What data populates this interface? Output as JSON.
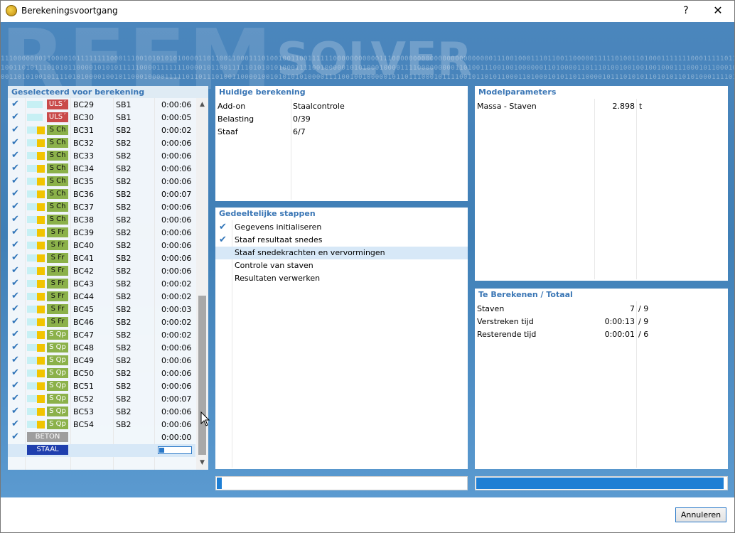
{
  "window": {
    "title": "Berekeningsvoortgang",
    "help_label": "?",
    "close_label": "✕"
  },
  "background": {
    "brand_word_1": "RFEM",
    "brand_word_2": "SOLVER",
    "binary_lines": [
      "1110000000110000101111111100011100101010101000011011001100011101001001100111111000000000001110000000000000000000000001110010001110110011000001111101001101000111111100011111011101010110010011111111111111110000011",
      "1001101011101010110000101010111110000111111100001011001111101010101000111100100000101010001000011110000000001101001110010010000001101000011011101001001001001000111000101100010010111101001100000001110110010001",
      "0011010100101111010100001001011000100001111101101110100110000100101010101000011110010010000010110111000101111001011010110001101000101011011000010111010101101010110101000111101010110011110101110001001010100111"
    ]
  },
  "left_panel": {
    "title": "Geselecteerd voor berekening",
    "rows": [
      {
        "check": "✔",
        "badge": "ULS´",
        "badge_type": "uls",
        "combo": "BC29",
        "sb": "SB1",
        "time": "0:00:06"
      },
      {
        "check": "✔",
        "badge": "ULS´",
        "badge_type": "uls",
        "combo": "BC30",
        "sb": "SB1",
        "time": "0:00:05"
      },
      {
        "check": "✔",
        "badge": "S Ch",
        "badge_type": "sch",
        "combo": "BC31",
        "sb": "SB2",
        "time": "0:00:02"
      },
      {
        "check": "✔",
        "badge": "S Ch",
        "badge_type": "sch",
        "combo": "BC32",
        "sb": "SB2",
        "time": "0:00:06"
      },
      {
        "check": "✔",
        "badge": "S Ch",
        "badge_type": "sch",
        "combo": "BC33",
        "sb": "SB2",
        "time": "0:00:06"
      },
      {
        "check": "✔",
        "badge": "S Ch",
        "badge_type": "sch",
        "combo": "BC34",
        "sb": "SB2",
        "time": "0:00:06"
      },
      {
        "check": "✔",
        "badge": "S Ch",
        "badge_type": "sch",
        "combo": "BC35",
        "sb": "SB2",
        "time": "0:00:06"
      },
      {
        "check": "✔",
        "badge": "S Ch",
        "badge_type": "sch",
        "combo": "BC36",
        "sb": "SB2",
        "time": "0:00:07"
      },
      {
        "check": "✔",
        "badge": "S Ch",
        "badge_type": "sch",
        "combo": "BC37",
        "sb": "SB2",
        "time": "0:00:06"
      },
      {
        "check": "✔",
        "badge": "S Ch",
        "badge_type": "sch",
        "combo": "BC38",
        "sb": "SB2",
        "time": "0:00:06"
      },
      {
        "check": "✔",
        "badge": "S Fr",
        "badge_type": "sfr",
        "combo": "BC39",
        "sb": "SB2",
        "time": "0:00:06"
      },
      {
        "check": "✔",
        "badge": "S Fr",
        "badge_type": "sfr",
        "combo": "BC40",
        "sb": "SB2",
        "time": "0:00:06"
      },
      {
        "check": "✔",
        "badge": "S Fr",
        "badge_type": "sfr",
        "combo": "BC41",
        "sb": "SB2",
        "time": "0:00:06"
      },
      {
        "check": "✔",
        "badge": "S Fr",
        "badge_type": "sfr",
        "combo": "BC42",
        "sb": "SB2",
        "time": "0:00:06"
      },
      {
        "check": "✔",
        "badge": "S Fr",
        "badge_type": "sfr",
        "combo": "BC43",
        "sb": "SB2",
        "time": "0:00:02"
      },
      {
        "check": "✔",
        "badge": "S Fr",
        "badge_type": "sfr",
        "combo": "BC44",
        "sb": "SB2",
        "time": "0:00:02"
      },
      {
        "check": "✔",
        "badge": "S Fr",
        "badge_type": "sfr",
        "combo": "BC45",
        "sb": "SB2",
        "time": "0:00:03"
      },
      {
        "check": "✔",
        "badge": "S Fr",
        "badge_type": "sfr",
        "combo": "BC46",
        "sb": "SB2",
        "time": "0:00:02"
      },
      {
        "check": "✔",
        "badge": "S Qp",
        "badge_type": "sqp",
        "combo": "BC47",
        "sb": "SB2",
        "time": "0:00:02"
      },
      {
        "check": "✔",
        "badge": "S Qp",
        "badge_type": "sqp",
        "combo": "BC48",
        "sb": "SB2",
        "time": "0:00:06"
      },
      {
        "check": "✔",
        "badge": "S Qp",
        "badge_type": "sqp",
        "combo": "BC49",
        "sb": "SB2",
        "time": "0:00:06"
      },
      {
        "check": "✔",
        "badge": "S Qp",
        "badge_type": "sqp",
        "combo": "BC50",
        "sb": "SB2",
        "time": "0:00:06"
      },
      {
        "check": "✔",
        "badge": "S Qp",
        "badge_type": "sqp",
        "combo": "BC51",
        "sb": "SB2",
        "time": "0:00:06"
      },
      {
        "check": "✔",
        "badge": "S Qp",
        "badge_type": "sqp",
        "combo": "BC52",
        "sb": "SB2",
        "time": "0:00:07"
      },
      {
        "check": "✔",
        "badge": "S Qp",
        "badge_type": "sqp",
        "combo": "BC53",
        "sb": "SB2",
        "time": "0:00:06"
      },
      {
        "check": "✔",
        "badge": "S Qp",
        "badge_type": "sqp",
        "combo": "BC54",
        "sb": "SB2",
        "time": "0:00:06"
      },
      {
        "check": "✔",
        "badge": "BETON",
        "badge_type": "beton",
        "combo": "",
        "sb": "",
        "time": "0:00:00"
      },
      {
        "check": "",
        "badge": "STAAL",
        "badge_type": "staal",
        "combo": "",
        "sb": "",
        "time": "",
        "progress": 0.15
      }
    ]
  },
  "current_calc": {
    "title": "Huidige berekening",
    "rows": [
      {
        "key": "Add-on",
        "value": "Staalcontrole"
      },
      {
        "key": "Belasting",
        "value": "0/39"
      },
      {
        "key": "Staaf",
        "value": "6/7"
      }
    ]
  },
  "steps": {
    "title": "Gedeeltelijke stappen",
    "items": [
      {
        "check": "✔",
        "label": "Gegevens initialiseren",
        "active": false
      },
      {
        "check": "✔",
        "label": "Staaf resultaat snedes",
        "active": false
      },
      {
        "check": "",
        "label": "Staaf snedekrachten en vervormingen",
        "active": true
      },
      {
        "check": "",
        "label": "Controle van staven",
        "active": false
      },
      {
        "check": "",
        "label": "Resultaten verwerken",
        "active": false
      }
    ]
  },
  "model_params": {
    "title": "Modelparameters",
    "rows": [
      {
        "name": "Massa - Staven",
        "value": "2.898",
        "unit": "t"
      }
    ]
  },
  "totals": {
    "title": "Te Berekenen / Totaal",
    "rows": [
      {
        "name": "Staven",
        "value": "7",
        "total": "/ 9"
      },
      {
        "name": "Verstreken tijd",
        "value": "0:00:13",
        "total": "/ 9"
      },
      {
        "name": "Resterende tijd",
        "value": "0:00:01",
        "total": "/ 6"
      }
    ]
  },
  "progress": {
    "steps_fraction": 0.02,
    "overall_fraction": 0.99
  },
  "buttons": {
    "cancel_label": "Annuleren"
  },
  "colors": {
    "accent": "#3a76b5",
    "progress": "#1f7fd4",
    "check": "#2f74b8",
    "uls_badge": "#c94a4a",
    "sls_badge": "#8bb14a",
    "beton_badge": "#9e9e9e",
    "staal_badge": "#1f3fae"
  },
  "icons": {
    "app": "rfem-app-icon",
    "check": "check-icon",
    "scroll_up": "chevron-up-icon",
    "scroll_down": "chevron-down-icon",
    "cursor": "mouse-pointer-icon"
  }
}
